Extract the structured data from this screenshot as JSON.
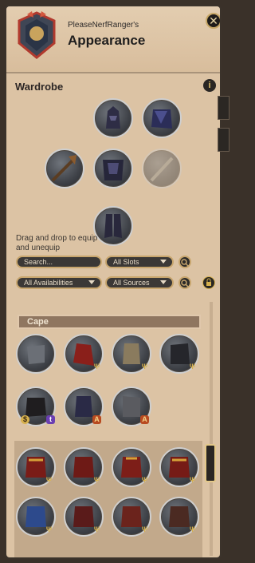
{
  "header": {
    "player_name": "PleaseNerfRanger's",
    "title": "Appearance",
    "close_icon": "✕"
  },
  "wardrobe": {
    "section_title": "Wardrobe",
    "info_icon": "i",
    "instructions": "Drag and drop to equip and unequip"
  },
  "filters": {
    "search_placeholder": "Search...",
    "slots_label": "All Slots",
    "availability_label": "All Availabilities",
    "sources_label": "All Sources"
  },
  "category": {
    "title": "Cape"
  },
  "colors": {
    "panel": "#dcc3a4",
    "accent_gold": "#c8a66e",
    "dark": "#2d2b29"
  }
}
